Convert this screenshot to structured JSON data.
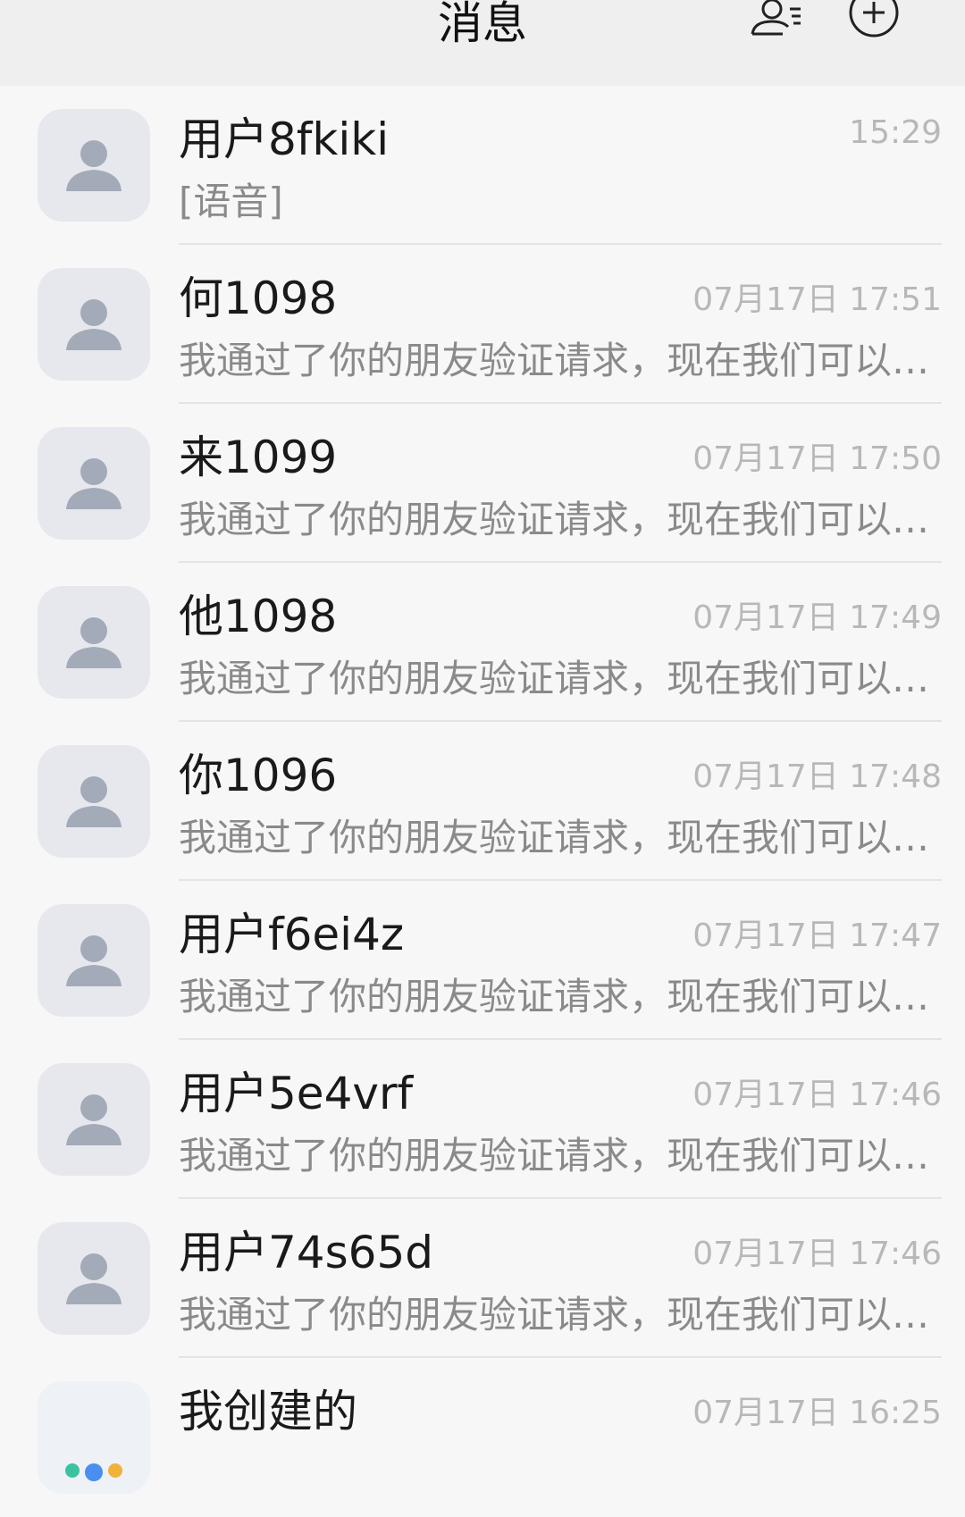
{
  "header": {
    "title": "消息"
  },
  "conversations": [
    {
      "name": "用户8fkiki",
      "time": "15:29",
      "preview": "[语音]"
    },
    {
      "name": "何1098",
      "time": "07月17日 17:51",
      "preview": "我通过了你的朋友验证请求，现在我们可以开始聊天了"
    },
    {
      "name": "来1099",
      "time": "07月17日 17:50",
      "preview": "我通过了你的朋友验证请求，现在我们可以开始聊天了"
    },
    {
      "name": "他1098",
      "time": "07月17日 17:49",
      "preview": "我通过了你的朋友验证请求，现在我们可以开始聊天了"
    },
    {
      "name": "你1096",
      "time": "07月17日 17:48",
      "preview": "我通过了你的朋友验证请求，现在我们可以开始聊天了"
    },
    {
      "name": "用户f6ei4z",
      "time": "07月17日 17:47",
      "preview": "我通过了你的朋友验证请求，现在我们可以开始聊天了"
    },
    {
      "name": "用户5e4vrf",
      "time": "07月17日 17:46",
      "preview": "我通过了你的朋友验证请求，现在我们可以开始聊天了"
    },
    {
      "name": "用户74s65d",
      "time": "07月17日 17:46",
      "preview": "我通过了你的朋友验证请求，现在我们可以开始聊天了"
    },
    {
      "name": "我创建的",
      "time": "07月17日 16:25",
      "preview": ""
    }
  ],
  "icons": {
    "contacts": "contacts-icon",
    "add": "add-circle-icon",
    "avatar": "user-avatar-icon",
    "group": "group-avatar-icon"
  },
  "colors": {
    "accent": "#e43b3b",
    "avatar_bg": "#e6e8ee",
    "avatar_fg": "#a3aab8"
  }
}
